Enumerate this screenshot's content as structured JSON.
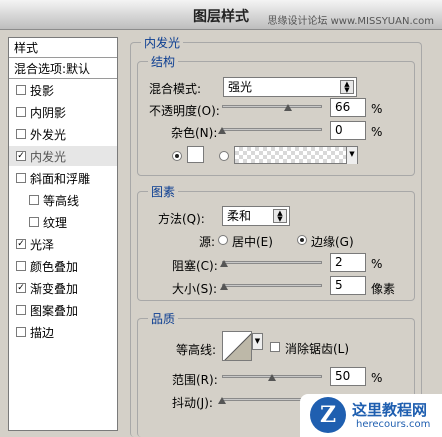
{
  "window": {
    "title": "图层样式",
    "watermark": "思缘设计论坛 www.MISSYUAN.com"
  },
  "left_panel": {
    "header": "样式",
    "blend_options": "混合选项:默认",
    "items": [
      {
        "label": "投影",
        "checked": false
      },
      {
        "label": "内阴影",
        "checked": false
      },
      {
        "label": "外发光",
        "checked": false
      },
      {
        "label": "内发光",
        "checked": true,
        "selected": true
      },
      {
        "label": "斜面和浮雕",
        "checked": false
      },
      {
        "label": "等高线",
        "checked": false,
        "sub": true
      },
      {
        "label": "纹理",
        "checked": false,
        "sub": true
      },
      {
        "label": "光泽",
        "checked": true
      },
      {
        "label": "颜色叠加",
        "checked": false
      },
      {
        "label": "渐变叠加",
        "checked": true
      },
      {
        "label": "图案叠加",
        "checked": false
      },
      {
        "label": "描边",
        "checked": false
      }
    ]
  },
  "inner_glow": {
    "title": "内发光",
    "structure": {
      "title": "结构",
      "blend_mode_label": "混合模式:",
      "blend_mode_value": "强光",
      "opacity_label": "不透明度(O):",
      "opacity_value": "66",
      "opacity_unit": "%",
      "opacity_level": 0.66,
      "noise_label": "杂色(N):",
      "noise_value": "0",
      "noise_unit": "%",
      "noise_level": 0.0
    },
    "elements": {
      "title": "图素",
      "method_label": "方法(Q):",
      "method_value": "柔和",
      "source_label": "源:",
      "source_center": "居中(E)",
      "source_edge": "边缘(G)",
      "choke_label": "阻塞(C):",
      "choke_value": "2",
      "choke_unit": "%",
      "choke_level": 0.02,
      "size_label": "大小(S):",
      "size_value": "5",
      "size_unit": "像素",
      "size_level": 0.02
    },
    "quality": {
      "title": "品质",
      "contour_label": "等高线:",
      "antialias_label": "消除锯齿(L)",
      "range_label": "范围(R):",
      "range_value": "50",
      "range_unit": "%",
      "range_level": 0.5,
      "jitter_label": "抖动(J):",
      "jitter_level": 0.0
    }
  },
  "logo": {
    "mark": "Z",
    "main": "这里教程网",
    "sub": "herecours.com"
  }
}
